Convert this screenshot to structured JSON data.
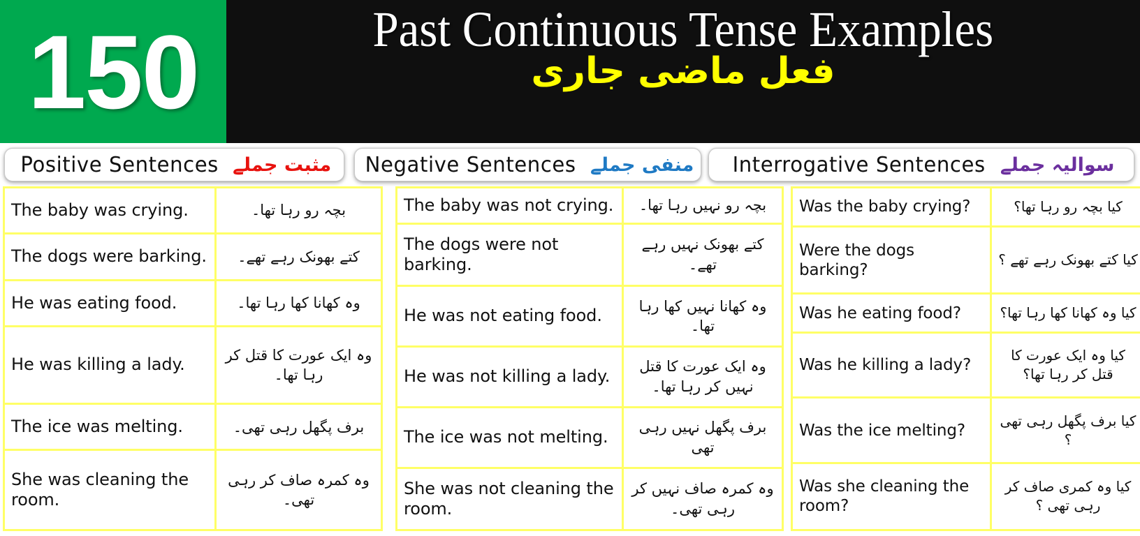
{
  "header": {
    "badge_number": "150",
    "title_en": "Past Continuous Tense Examples",
    "title_ur": "فعل ماضی جاری"
  },
  "colors": {
    "badge_green": "#00a94f",
    "header_black": "#0f0f0f",
    "title_yellow": "#ffff00",
    "grid_yellow": "#ffff66",
    "positive_accent": "#e8120e",
    "negative_accent": "#1f7ac4",
    "interrogative_accent": "#6b2f9e"
  },
  "tabs": [
    {
      "label_en": "Positive  Sentences",
      "label_ur": "مثبت جملے",
      "accent": "#e8120e"
    },
    {
      "label_en": "Negative  Sentences",
      "label_ur": "منفی جملے",
      "accent": "#1f7ac4"
    },
    {
      "label_en": "Interrogative  Sentences",
      "label_ur": "سوالیہ جملے",
      "accent": "#6b2f9e"
    }
  ],
  "tables": [
    {
      "name": "positive",
      "rows": [
        {
          "en": "The baby was crying.",
          "ur": "بچہ رو رہا تھا۔"
        },
        {
          "en": "The dogs were barking.",
          "ur": "کتے بھونک رہے تھے۔"
        },
        {
          "en": "He was eating food.",
          "ur": "وہ کھانا کھا رہا تھا۔"
        },
        {
          "en": "He was killing a lady.",
          "ur": "وہ ایک عورت کا قتل کر رہا تھا۔"
        },
        {
          "en": "The ice was melting.",
          "ur": "برف پگھل رہی تھی۔"
        },
        {
          "en": "She was cleaning the room.",
          "ur": "وہ کمرہ صاف کر رہی تھی۔"
        }
      ]
    },
    {
      "name": "negative",
      "rows": [
        {
          "en": " The baby was not crying.",
          "ur": "بچہ رو نہیں رہا تھا۔"
        },
        {
          "en": "The dogs were not barking.",
          "ur": "کتے بھونک نہیں رہے تھے۔"
        },
        {
          "en": "He was not eating food.",
          "ur": "وہ کھانا نہیں کھا رہا تھا۔"
        },
        {
          "en": " He was not killing a lady.",
          "ur": "وہ ایک عورت کا قتل نہیں کر رہا تھا۔"
        },
        {
          "en": "The ice was not melting.",
          "ur": "برف پگھل نہیں رہی تھی"
        },
        {
          "en": "She was not cleaning the room.",
          "ur": "وہ کمرہ صاف نہیں کر رہی تھی۔"
        }
      ]
    },
    {
      "name": "interrogative",
      "rows": [
        {
          "en": " Was the baby crying?",
          "ur": "کیا بچہ رو رہا تھا؟"
        },
        {
          "en": "Were the dogs barking?",
          "ur": "کیا کتے بھونک رہے تھے ؟"
        },
        {
          "en": "Was he eating food?",
          "ur": "کیا وہ کھانا کھا رہا تھا؟"
        },
        {
          "en": " Was he killing a lady?",
          "ur": "کیا وہ ایک عورت کا قتل کر رہا تھا؟"
        },
        {
          "en": "Was the ice melting?",
          "ur": "کیا برف پگھل رہی تھی ؟"
        },
        {
          "en": "Was she cleaning the room?",
          "ur": "کیا وہ کمری صاف کر رہی تھی ؟"
        }
      ]
    }
  ]
}
